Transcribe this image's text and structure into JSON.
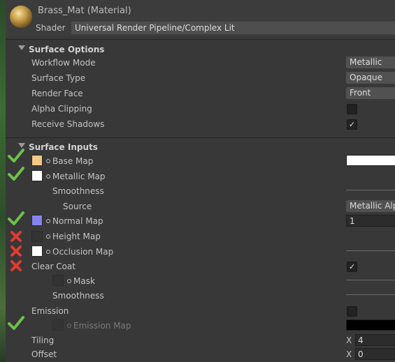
{
  "header": {
    "title": "Brass_Mat (Material)",
    "shader_label": "Shader",
    "shader_value": "Universal Render Pipeline/Complex Lit"
  },
  "surface_options": {
    "title": "Surface Options",
    "workflow_mode": {
      "label": "Workflow Mode",
      "value": "Metallic"
    },
    "surface_type": {
      "label": "Surface Type",
      "value": "Opaque"
    },
    "render_face": {
      "label": "Render Face",
      "value": "Front"
    },
    "alpha_clipping": {
      "label": "Alpha Clipping",
      "checked": false
    },
    "receive_shadows": {
      "label": "Receive Shadows",
      "checked": true
    }
  },
  "surface_inputs": {
    "title": "Surface Inputs",
    "base_map": {
      "label": "Base Map",
      "swatch": "#f1c884",
      "color": "#ffffff"
    },
    "metallic_map": {
      "label": "Metallic Map",
      "swatch": "#ffffff"
    },
    "smoothness": {
      "label": "Smoothness"
    },
    "source": {
      "label": "Source",
      "value": "Metallic Alpha"
    },
    "normal_map": {
      "label": "Normal Map",
      "swatch": "#8484f0",
      "value": "1"
    },
    "height_map": {
      "label": "Height Map"
    },
    "occlusion_map": {
      "label": "Occlusion Map",
      "swatch": "#ffffff"
    },
    "clear_coat": {
      "label": "Clear Coat",
      "checked": true
    },
    "mask": {
      "label": "Mask"
    },
    "smoothness2": {
      "label": "Smoothness"
    },
    "emission": {
      "label": "Emission",
      "checked": false
    },
    "emission_map": {
      "label": "Emission Map",
      "color": "#000000"
    },
    "tiling": {
      "label": "Tiling",
      "axis": "X",
      "value": "4"
    },
    "offset": {
      "label": "Offset",
      "axis": "X",
      "value": "0"
    }
  },
  "status_marks": {
    "check_color": "#6cc24a",
    "cross_color": "#e23b2e",
    "checks": [
      "base_map",
      "metallic_map",
      "normal_map",
      "emission"
    ],
    "crosses": [
      "height_map",
      "occlusion_map",
      "clear_coat"
    ]
  },
  "icons": {
    "section_toggle": "triangle-down-icon",
    "texture_picker": "texture-picker-dot-icon",
    "check": "green-check-icon",
    "cross": "red-x-icon",
    "checkbox_tick": "✓"
  }
}
